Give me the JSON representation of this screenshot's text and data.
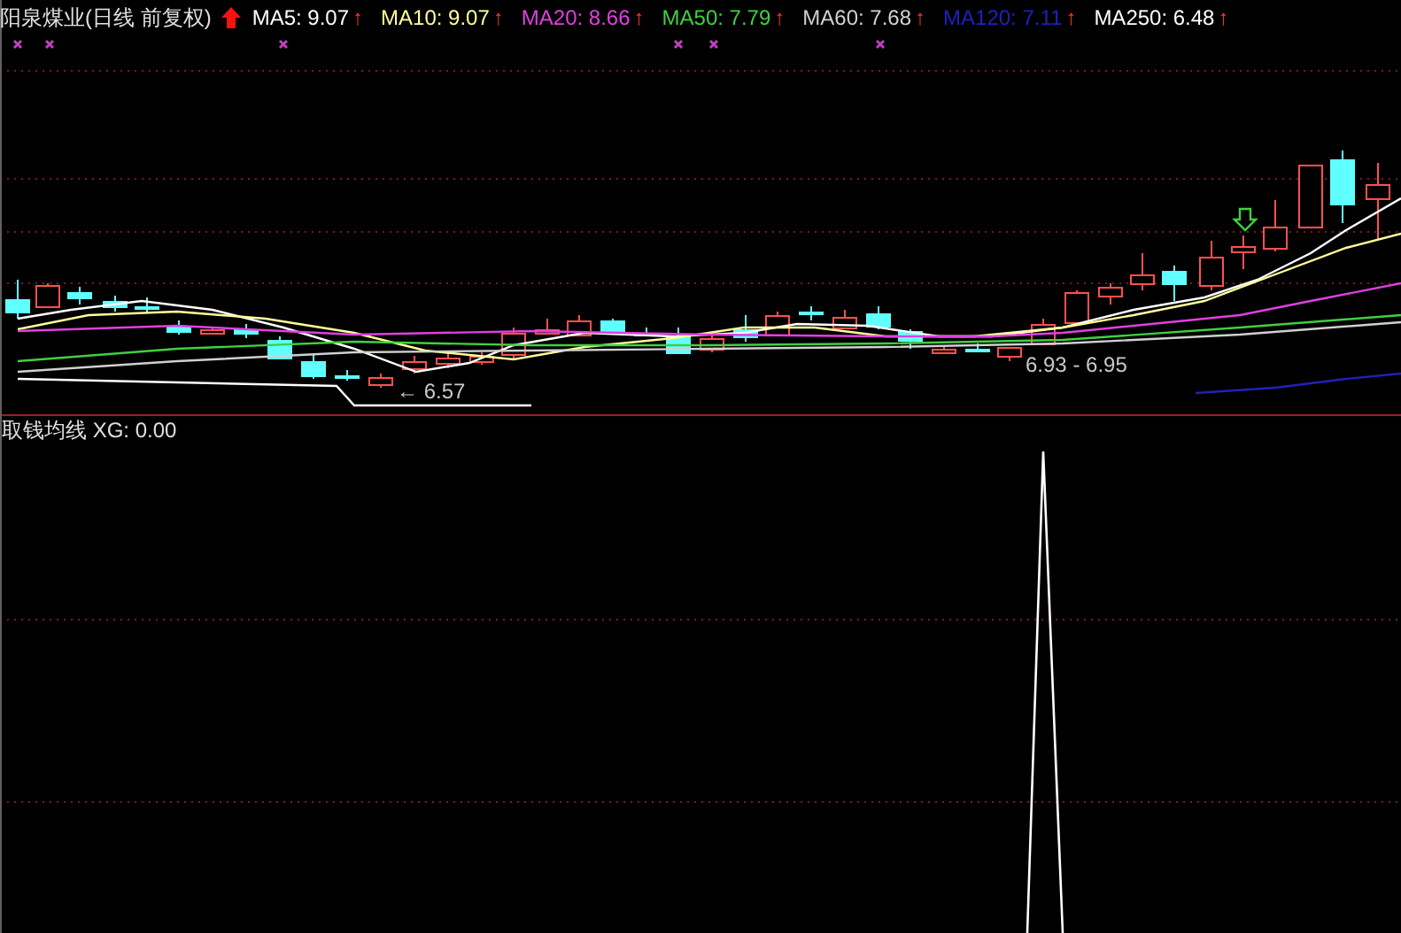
{
  "chart": {
    "title": "阳泉煤业(日线 前复权)",
    "indicators": [
      {
        "label": "MA5: 9.07",
        "arrow": "↑",
        "color": "#ffffff"
      },
      {
        "label": "MA10: 9.07",
        "arrow": "↑",
        "color": "#ffff99"
      },
      {
        "label": "MA20: 8.66",
        "arrow": "↑",
        "color": "#e040e0"
      },
      {
        "label": "MA50: 7.79",
        "arrow": "↑",
        "color": "#40d040"
      },
      {
        "label": "MA60: 7.68",
        "arrow": "↑",
        "color": "#d0d0d0"
      },
      {
        "label": "MA120: 7.11",
        "arrow": "↑",
        "color": "#2020c0"
      },
      {
        "label": "MA250: 6.48",
        "arrow": "↑",
        "color": "#ffffff"
      }
    ],
    "price_labels": [
      "← 6.57",
      "6.93 - 6.95"
    ]
  },
  "indicator_panel": {
    "label": "取钱均线 XG: 0.00"
  }
}
